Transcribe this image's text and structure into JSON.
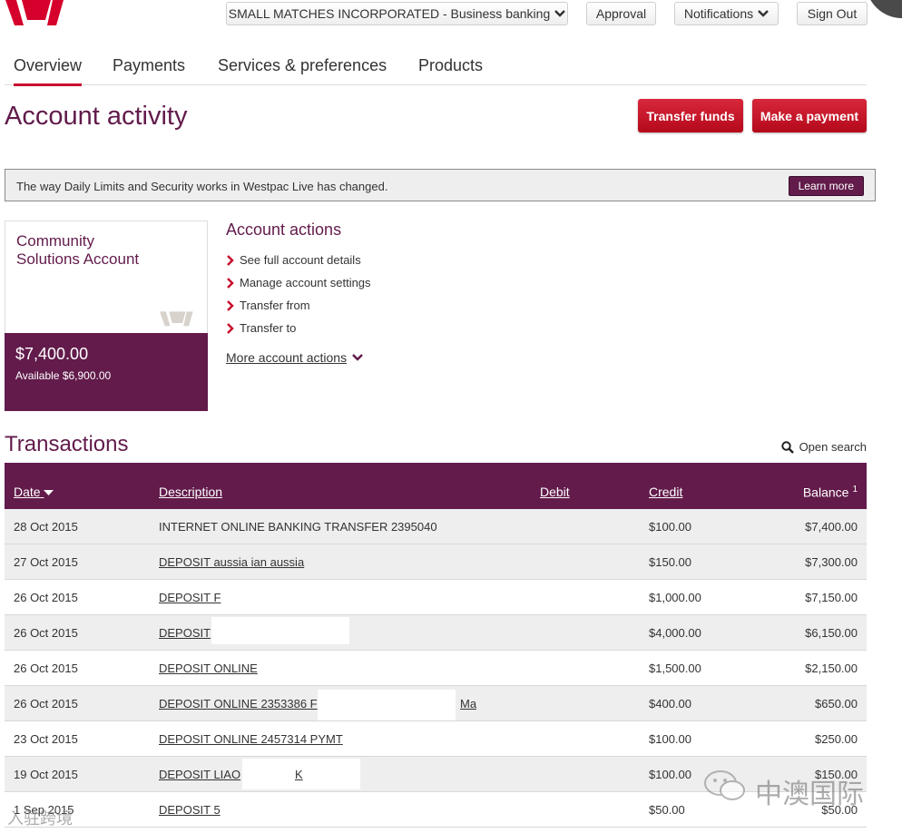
{
  "header": {
    "business_select": "SMALL MATCHES INCORPORATED - Business banking",
    "approval": "Approval",
    "notifications": "Notifications",
    "sign_out": "Sign Out"
  },
  "tabs": [
    {
      "label": "Overview",
      "active": true
    },
    {
      "label": "Payments",
      "active": false
    },
    {
      "label": "Services & preferences",
      "active": false
    },
    {
      "label": "Products",
      "active": false
    }
  ],
  "page": {
    "title": "Account activity",
    "transfer_button": "Transfer funds",
    "payment_button": "Make a payment"
  },
  "notice": {
    "text": "The way Daily Limits and Security works in Westpac Live has changed.",
    "button": "Learn more"
  },
  "account": {
    "name": "Community Solutions Account",
    "balance": "$7,400.00",
    "available": "Available $6,900.00"
  },
  "account_actions": {
    "title": "Account actions",
    "items": [
      "See full account details",
      "Manage account settings",
      "Transfer from",
      "Transfer to"
    ],
    "more": "More account actions"
  },
  "transactions": {
    "title": "Transactions",
    "open_search": "Open search",
    "columns": {
      "date": "Date",
      "description": "Description",
      "debit": "Debit",
      "credit": "Credit",
      "balance": "Balance",
      "balance_note": "1"
    },
    "rows": [
      {
        "date": "28 Oct 2015",
        "description": "INTERNET ONLINE BANKING TRANSFER 2395040",
        "debit": "",
        "credit": "$100.00",
        "balance": "$7,400.00"
      },
      {
        "date": "27 Oct 2015",
        "description": "DEPOSIT aussia ian aussia",
        "debit": "",
        "credit": "$150.00",
        "balance": "$7,300.00"
      },
      {
        "date": "26 Oct 2015",
        "description": "DEPOSIT F",
        "debit": "",
        "credit": "$1,000.00",
        "balance": "$7,150.00"
      },
      {
        "date": "26 Oct 2015",
        "description": "DEPOSIT",
        "debit": "",
        "credit": "$4,000.00",
        "balance": "$6,150.00"
      },
      {
        "date": "26 Oct 2015",
        "description": "DEPOSIT ONLINE",
        "debit": "",
        "credit": "$1,500.00",
        "balance": "$2,150.00"
      },
      {
        "date": "26 Oct 2015",
        "description": "DEPOSIT ONLINE 2353386 F",
        "description_tail": "Ma",
        "debit": "",
        "credit": "$400.00",
        "balance": "$650.00"
      },
      {
        "date": "23 Oct 2015",
        "description": "DEPOSIT ONLINE 2457314 PYMT",
        "debit": "",
        "credit": "$100.00",
        "balance": "$250.00"
      },
      {
        "date": "19 Oct 2015",
        "description": "DEPOSIT LIAO",
        "description_tail": "K",
        "debit": "",
        "credit": "$100.00",
        "balance": "$150.00"
      },
      {
        "date": "1 Sep 2015",
        "description": "DEPOSIT 5",
        "debit": "",
        "credit": "$50.00",
        "balance": "$50.00"
      }
    ]
  },
  "watermark": {
    "right_text": "中澳国际",
    "left_text": "入驻跨境"
  },
  "colors": {
    "brand": "#621b4b",
    "accent": "#c8102e",
    "row_alt": "#efeeee"
  }
}
